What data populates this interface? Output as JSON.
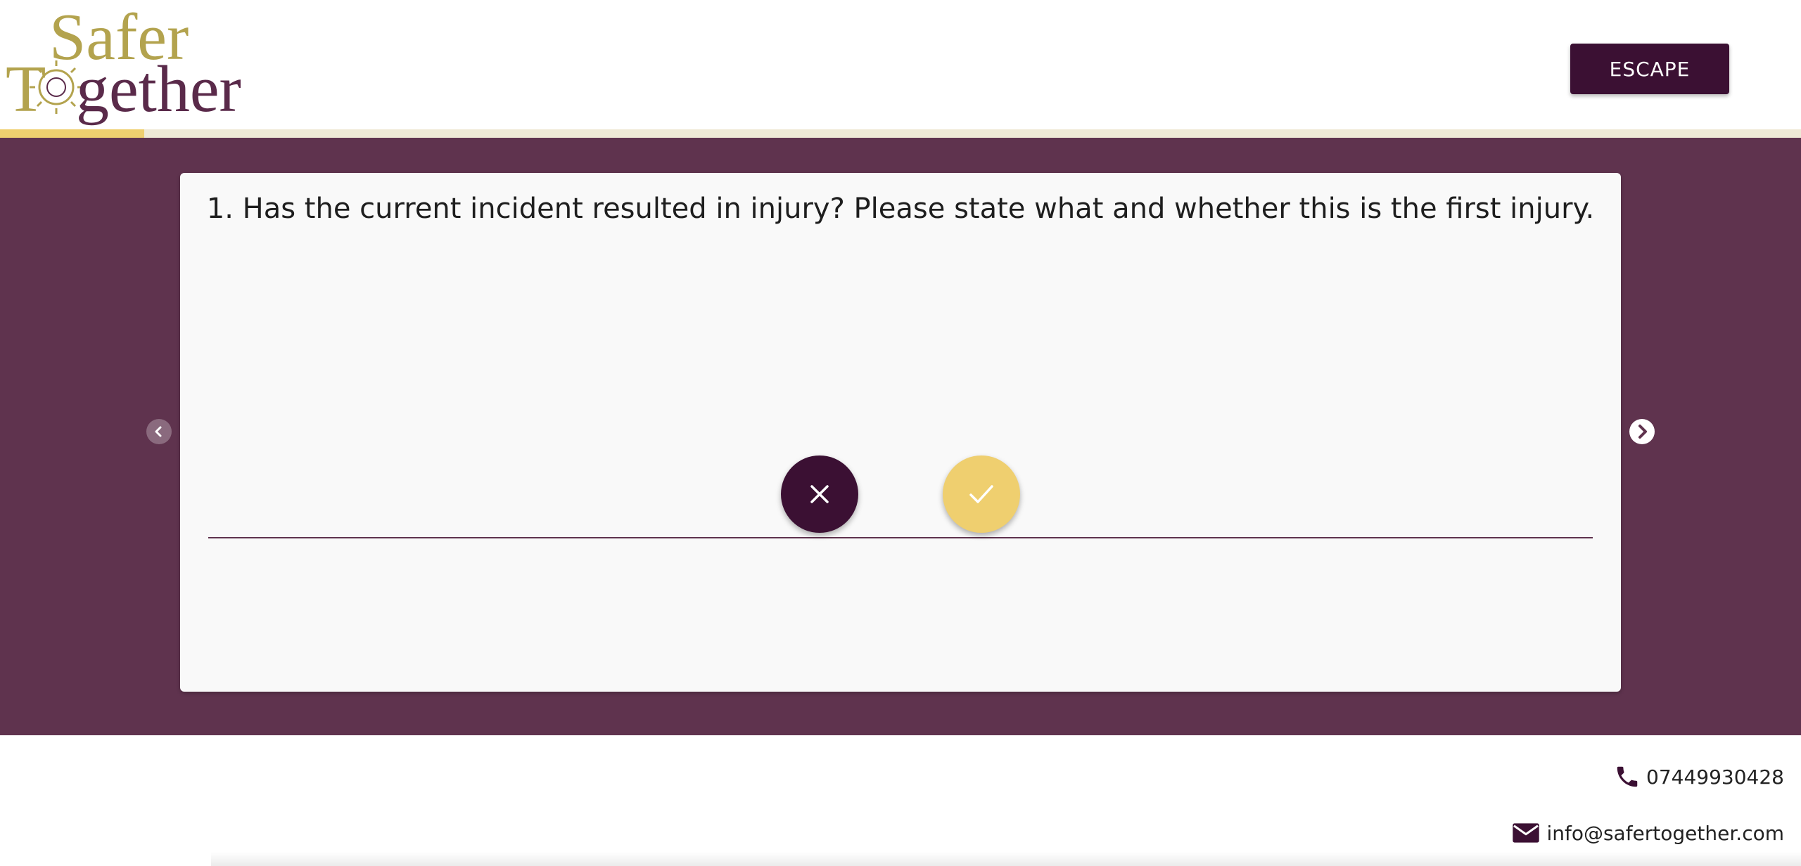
{
  "header": {
    "logo_text_line1": "Safer",
    "logo_text_line2": "Together",
    "escape_label": "ESCAPE"
  },
  "progress": {
    "fraction": 0.08
  },
  "question": {
    "text": "1. Has the current incident resulted in injury? Please state what and whether this is the first injury.",
    "answer_value": "",
    "no_icon": "close-icon",
    "yes_icon": "check-icon"
  },
  "navigation": {
    "prev_icon": "chevron-left-icon",
    "next_icon": "chevron-right-icon"
  },
  "contact": {
    "phone": "07449930428",
    "email": "info@safertogether.com"
  },
  "colors": {
    "brand_purple": "#3b1033",
    "band_purple": "#5f334e",
    "accent_yellow": "#efcf6f",
    "logo_gold": "#b3a34e"
  }
}
